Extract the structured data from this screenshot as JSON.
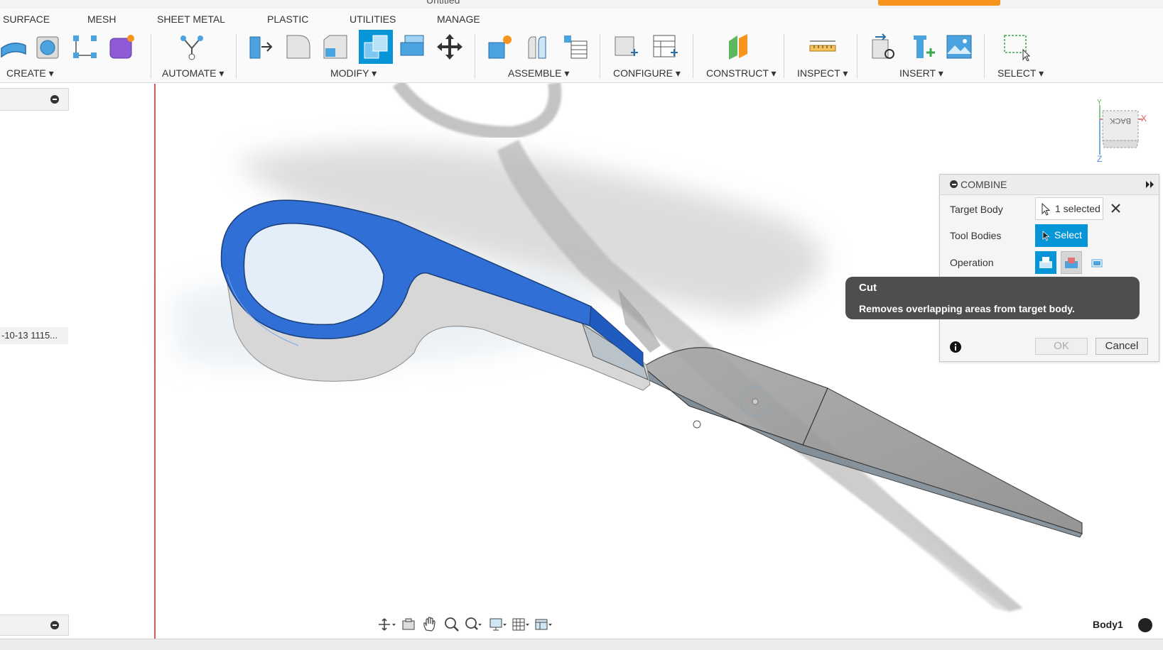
{
  "window": {
    "title": "Untitled"
  },
  "tabs": [
    "SURFACE",
    "MESH",
    "SHEET METAL",
    "PLASTIC",
    "UTILITIES",
    "MANAGE"
  ],
  "toolbar": {
    "groups": {
      "create": "CREATE ▾",
      "automate": "AUTOMATE ▾",
      "modify": "MODIFY ▾",
      "assemble": "ASSEMBLE ▾",
      "configure": "CONFIGURE ▾",
      "construct": "CONSTRUCT ▾",
      "inspect": "INSPECT ▾",
      "insert": "INSERT ▾",
      "select": "SELECT ▾"
    }
  },
  "browser": {
    "item_label": "-10-13 1115..."
  },
  "combine_dialog": {
    "title": "COMBINE",
    "target_body_label": "Target Body",
    "target_body_value": "1 selected",
    "tool_bodies_label": "Tool Bodies",
    "tool_bodies_button": "Select",
    "operation_label": "Operation",
    "ok_label": "OK",
    "cancel_label": "Cancel"
  },
  "tooltip": {
    "title": "Cut",
    "description": "Removes overlapping areas from target body."
  },
  "viewcube": {
    "face_label": "BACK",
    "x_axis": "X",
    "y_axis": "Y",
    "z_axis": "Z"
  },
  "statusbar": {
    "active_body": "Body1"
  },
  "colors": {
    "accent_blue": "#0696d7",
    "tooltip_bg": "#4e4e4e",
    "handle_blue": "#2f6fd6",
    "title_orange": "#f7941d"
  }
}
